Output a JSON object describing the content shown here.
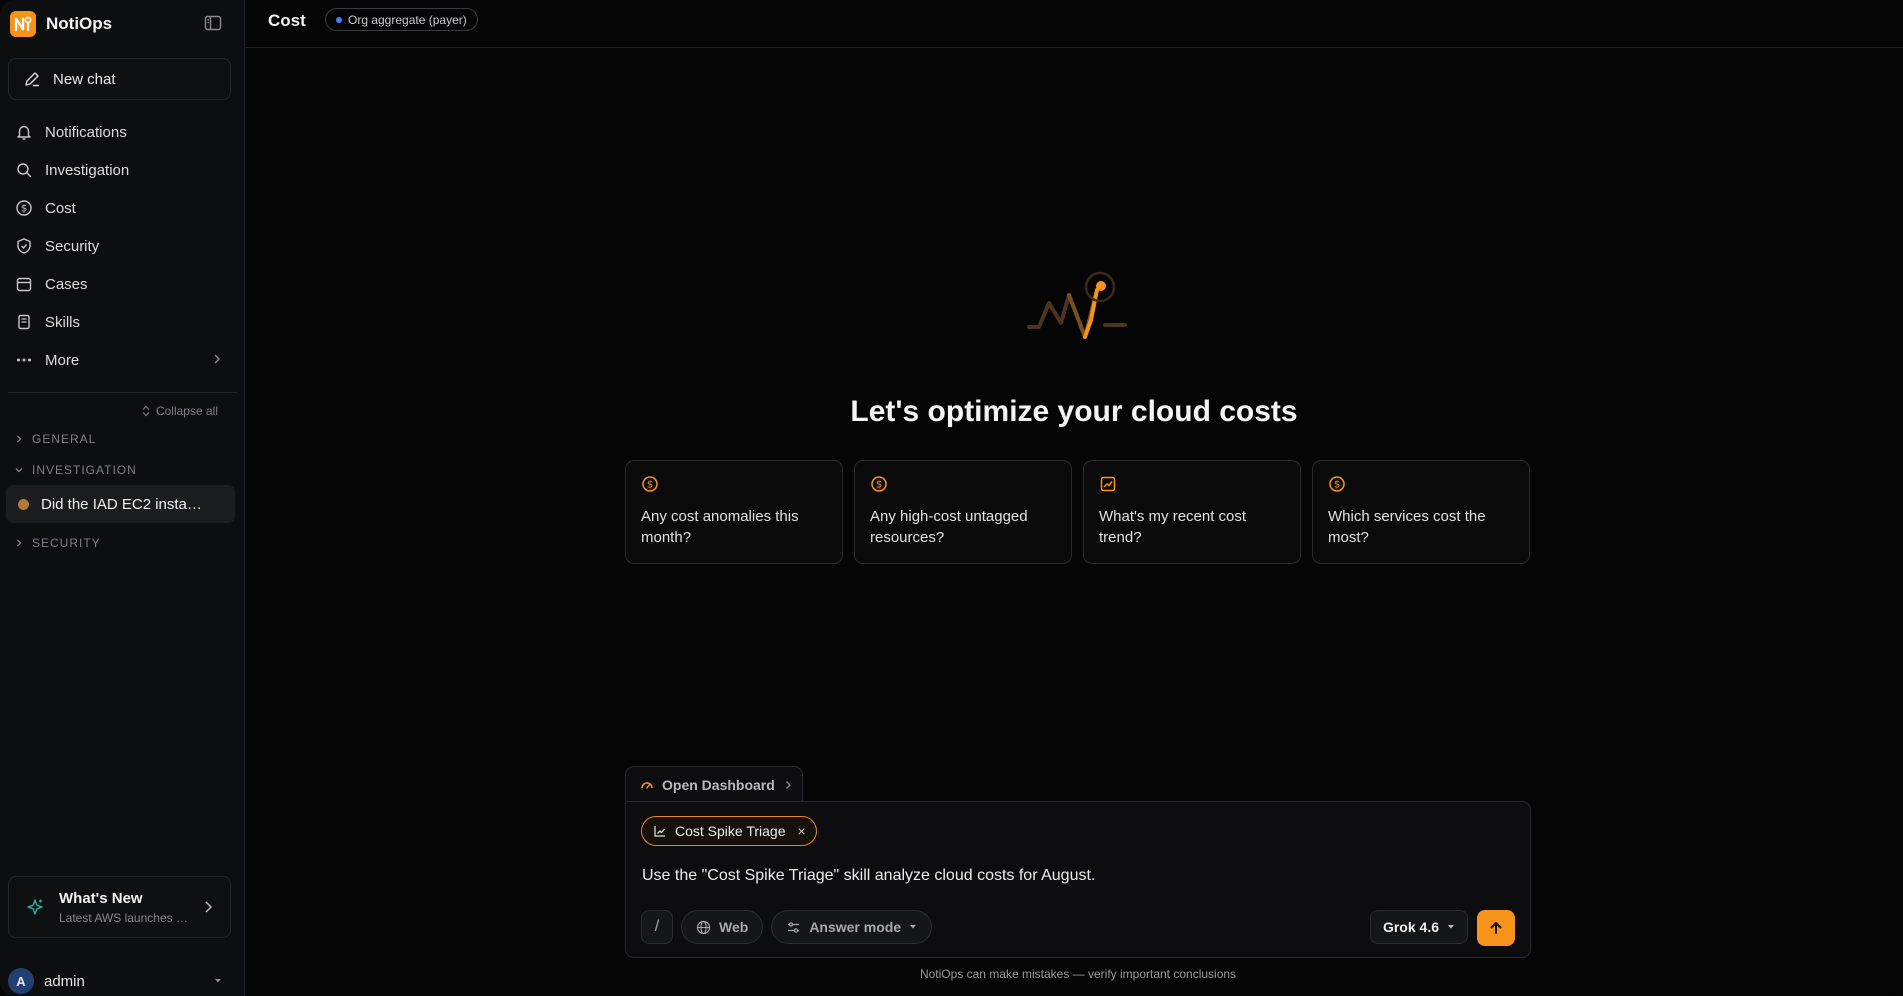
{
  "app": {
    "name": "NotiOps"
  },
  "colors": {
    "accent": "#f7931a",
    "background": "#050505",
    "sidebar": "#0d0e10",
    "scope_dot": "#3b82f6"
  },
  "sidebar": {
    "new_chat_label": "New chat",
    "items": [
      {
        "label": "Notifications",
        "icon": "bell-icon"
      },
      {
        "label": "Investigation",
        "icon": "search-icon"
      },
      {
        "label": "Cost",
        "icon": "dollar-circle-icon"
      },
      {
        "label": "Security",
        "icon": "shield-icon"
      },
      {
        "label": "Cases",
        "icon": "calendar-icon"
      },
      {
        "label": "Skills",
        "icon": "book-icon"
      },
      {
        "label": "More",
        "icon": "more-dots-icon"
      }
    ],
    "collapse_all_label": "Collapse all",
    "sections": {
      "general": "GENERAL",
      "investigation": "INVESTIGATION",
      "security": "SECURITY"
    },
    "threads": [
      {
        "label": "Did the IAD EC2 insta…"
      }
    ],
    "whats_new": {
      "title": "What's New",
      "subtitle": "Latest AWS launches …"
    },
    "user": {
      "initial": "A",
      "name": "admin"
    }
  },
  "header": {
    "title": "Cost",
    "scope_badge": "Org aggregate (payer)"
  },
  "hero": {
    "title": "Let's optimize your cloud costs"
  },
  "suggestions": [
    {
      "icon": "dollar-circle-icon",
      "text": "Any cost anomalies this month?"
    },
    {
      "icon": "dollar-circle-icon",
      "text": "Any high-cost untagged resources?"
    },
    {
      "icon": "trend-chart-icon",
      "text": "What's my recent cost trend?"
    },
    {
      "icon": "dollar-circle-icon",
      "text": "Which services cost the most?"
    }
  ],
  "composer": {
    "dashboard_tab": "Open Dashboard",
    "skill_chip": "Cost Spike Triage",
    "input_value": "Use the \"Cost Spike Triage\" skill analyze cloud costs for August.",
    "slash_label": "/",
    "web_label": "Web",
    "answer_mode_label": "Answer mode",
    "model": "Grok 4.6"
  },
  "footer_note": "NotiOps can make mistakes — verify important conclusions"
}
